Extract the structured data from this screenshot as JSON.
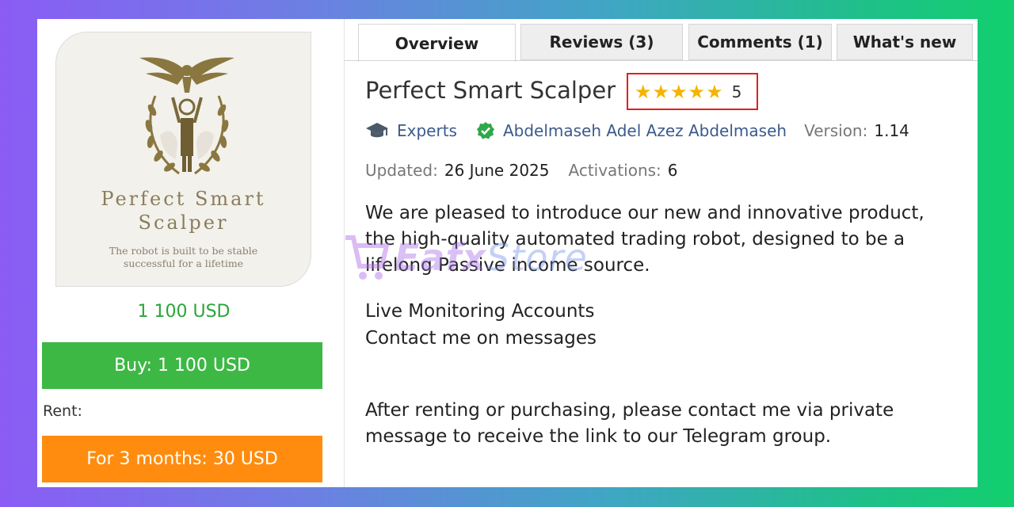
{
  "product": {
    "image": {
      "title_line1": "Perfect Smart",
      "title_line2": "Scalper",
      "subtitle_line1": "The robot is built to be stable",
      "subtitle_line2": "successful for a lifetime"
    },
    "price": "1 100 USD",
    "buy_label": "Buy: 1 100 USD",
    "rent_label": "Rent:",
    "rent_option_label": "For 3 months: 30 USD"
  },
  "tabs": [
    {
      "label": "Overview",
      "active": true
    },
    {
      "label": "Reviews (3)",
      "active": false
    },
    {
      "label": "Comments (1)",
      "active": false
    },
    {
      "label": "What's new",
      "active": false
    }
  ],
  "details": {
    "title": "Perfect Smart Scalper",
    "rating": {
      "stars": 5,
      "value": "5"
    },
    "category": "Experts",
    "author": "Abdelmaseh Adel Azez Abdelmaseh",
    "version_label": "Version:",
    "version": "1.14",
    "updated_label": "Updated:",
    "updated": "26 June 2025",
    "activations_label": "Activations:",
    "activations": "6"
  },
  "description": {
    "paragraph1_line1": "We are pleased to introduce our new and innovative product,",
    "paragraph1_line2": "the high-quality automated trading robot, designed to be a",
    "paragraph1_line3": "lifelong Passive income source.",
    "line_live": "Live Monitoring Accounts",
    "line_contact": "Contact me on messages",
    "paragraph3_line1": "After renting or purchasing, please contact me via private",
    "paragraph3_line2": "message to receive the link to our Telegram group."
  },
  "watermark": {
    "brand": "Eafx",
    "suffix": "Store"
  },
  "colors": {
    "buy": "#3db845",
    "rent": "#ff8c0f",
    "price": "#2aa53a",
    "star": "#f5b400",
    "rating_border": "#e02020",
    "link": "#3b5a8a"
  },
  "icons": {
    "category": "graduation-cap-icon",
    "verified": "verified-check-icon",
    "star": "star-icon"
  }
}
